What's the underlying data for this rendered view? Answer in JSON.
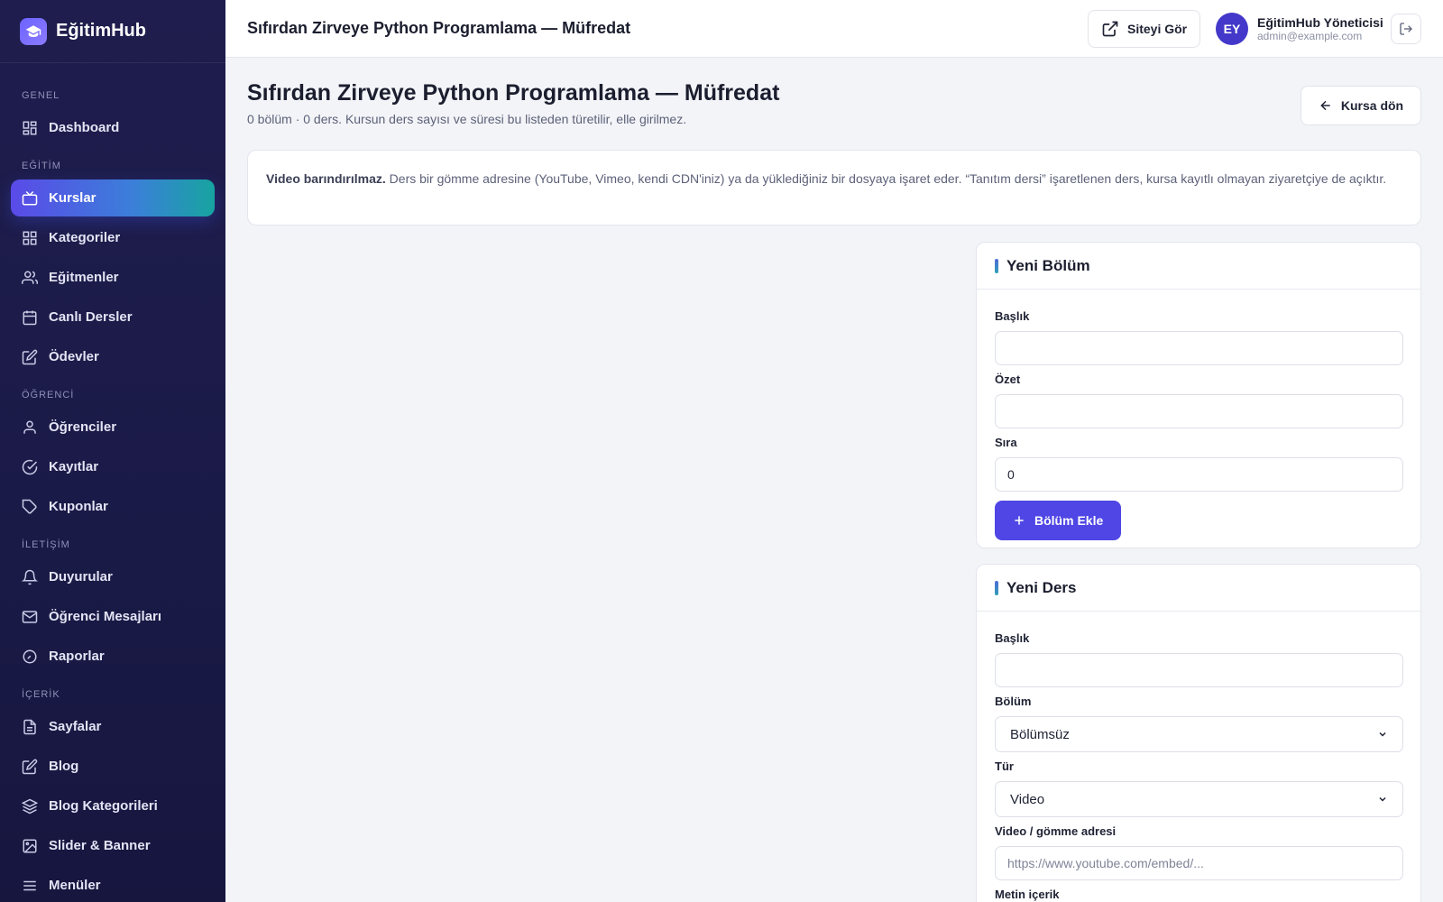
{
  "brand": {
    "name": "EğitimHub"
  },
  "sidebar": {
    "sections": [
      {
        "label": "GENEL",
        "items": [
          {
            "label": "Dashboard",
            "icon": "grid-icon"
          }
        ]
      },
      {
        "label": "EĞİTİM",
        "items": [
          {
            "label": "Kurslar",
            "icon": "tv-icon",
            "active": true
          },
          {
            "label": "Kategoriler",
            "icon": "grid-icon"
          },
          {
            "label": "Eğitmenler",
            "icon": "users-icon"
          },
          {
            "label": "Canlı Dersler",
            "icon": "calendar-icon"
          },
          {
            "label": "Ödevler",
            "icon": "edit-icon"
          }
        ]
      },
      {
        "label": "ÖĞRENCİ",
        "items": [
          {
            "label": "Öğrenciler",
            "icon": "user-icon"
          },
          {
            "label": "Kayıtlar",
            "icon": "check-circle-icon"
          },
          {
            "label": "Kuponlar",
            "icon": "tag-icon"
          }
        ]
      },
      {
        "label": "İLETİŞİM",
        "items": [
          {
            "label": "Duyurular",
            "icon": "bell-icon"
          },
          {
            "label": "Öğrenci Mesajları",
            "icon": "mail-icon"
          },
          {
            "label": "Raporlar",
            "icon": "gauge-icon"
          }
        ]
      },
      {
        "label": "İÇERİK",
        "items": [
          {
            "label": "Sayfalar",
            "icon": "file-icon"
          },
          {
            "label": "Blog",
            "icon": "edit-icon"
          },
          {
            "label": "Blog Kategorileri",
            "icon": "layers-icon"
          },
          {
            "label": "Slider & Banner",
            "icon": "image-icon"
          },
          {
            "label": "Menüler",
            "icon": "menu-icon"
          }
        ]
      }
    ]
  },
  "topbar": {
    "title": "Sıfırdan Zirveye Python Programlama — Müfredat",
    "site_button": "Siteyi Gör",
    "user": {
      "initials": "EY",
      "name": "EğitimHub Yöneticisi",
      "email": "admin@example.com"
    }
  },
  "page": {
    "title": "Sıfırdan Zirveye Python Programlama — Müfredat",
    "subtitle": "0 bölüm · 0 ders. Kursun ders sayısı ve süresi bu listeden türetilir, elle girilmez.",
    "back_button": "Kursa dön",
    "info_bold": "Video barındırılmaz.",
    "info_text": " Ders bir gömme adresine (YouTube, Vimeo, kendi CDN'iniz) ya da yüklediğiniz bir dosyaya işaret eder. “Tanıtım dersi” işaretlenen ders, kursa kayıtlı olmayan ziyaretçiye de açıktır."
  },
  "new_section": {
    "title": "Yeni Bölüm",
    "title_label": "Başlık",
    "title_value": "",
    "summary_label": "Özet",
    "summary_value": "",
    "order_label": "Sıra",
    "order_value": "0",
    "submit": "Bölüm Ekle"
  },
  "new_lesson": {
    "title": "Yeni Ders",
    "title_label": "Başlık",
    "title_value": "",
    "section_label": "Bölüm",
    "section_value": "Bölümsüz",
    "type_label": "Tür",
    "type_value": "Video",
    "video_label": "Video / gömme adresi",
    "video_placeholder": "https://www.youtube.com/embed/...",
    "text_label": "Metin içerik"
  },
  "colors": {
    "primary": "#4f46e5",
    "sidebar_bg": "#1f1d4d",
    "avatar": "#4338ca"
  }
}
